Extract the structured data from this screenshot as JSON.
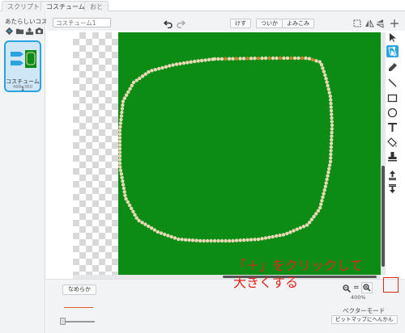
{
  "tabs": [
    {
      "label": "スクリプト"
    },
    {
      "label": "コスチューム"
    },
    {
      "label": "おと"
    }
  ],
  "left_panel": {
    "new_costume_label": "あたらしいコスチューム:",
    "tool_icons": [
      "paint-brush-icon",
      "folder-icon",
      "upload-icon",
      "camera-icon"
    ],
    "costume": {
      "name": "コスチューム1",
      "size": "468x360"
    }
  },
  "editor": {
    "name_placeholder": "コスチューム1",
    "undo_icon": "undo-icon",
    "redo_icon": "redo-icon",
    "buttons": {
      "clear": "けす",
      "add": "ついか",
      "import": "よみこみ"
    },
    "top_right_icons": [
      "shape-fit-icon",
      "flip-horizontal-icon",
      "flip-vertical-icon",
      "set-center-icon"
    ],
    "tools": [
      "select-arrow-icon",
      "reshape-icon",
      "pencil-icon",
      "line-icon",
      "rectangle-icon",
      "ellipse-icon",
      "text-icon",
      "fill-icon",
      "stamp-icon",
      "forward-layer-icon",
      "back-layer-icon"
    ],
    "active_tool": "reshape-icon"
  },
  "bottom": {
    "smooth_button": "なめらか",
    "zoom_equal": "=",
    "zoom_level": "400%",
    "mode_label": "ベクターモード",
    "bitmap_button": "ビットマップにへんかん"
  },
  "annotation": "「＋」をクリックして\n大きくする",
  "colors": {
    "canvas_green": "#0d8c15",
    "accent_blue": "#2aa3e0",
    "annotation_red": "#e0261b",
    "stroke_orange": "#e05a2a",
    "outline_dot": "#e8d9b5"
  }
}
